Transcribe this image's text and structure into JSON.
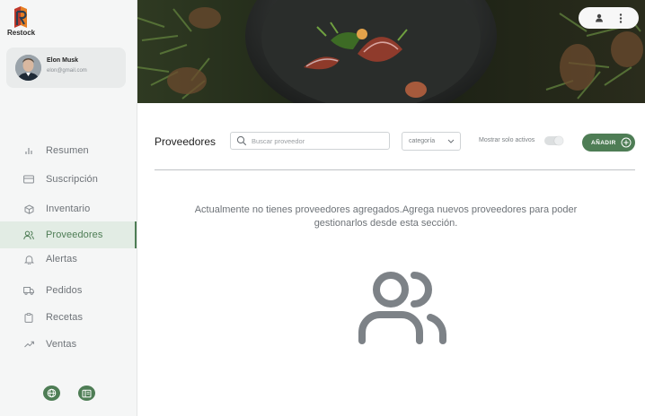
{
  "app": {
    "logo_text": "Restock"
  },
  "user": {
    "name": "Elon Musk",
    "email": "elon@gmail.com"
  },
  "sidebar": {
    "items": [
      {
        "label": "Resumen",
        "icon": "bar-chart-icon"
      },
      {
        "label": "Suscripción",
        "icon": "credit-card-icon"
      },
      {
        "label": "Inventario",
        "icon": "box-icon"
      },
      {
        "label": "Proveedores",
        "icon": "users-icon",
        "active": true
      },
      {
        "label": "Alertas",
        "icon": "bell-icon"
      },
      {
        "label": "Pedidos",
        "icon": "truck-icon"
      },
      {
        "label": "Recetas",
        "icon": "clipboard-icon"
      },
      {
        "label": "Ventas",
        "icon": "trend-up-icon"
      }
    ],
    "bottom_icons": [
      "globe-icon",
      "book-icon"
    ]
  },
  "toolbar": {
    "title": "Proveedores",
    "search_placeholder": "Buscar proveedor",
    "category_value": "categoría",
    "toggle_label": "Mostrar solo activos",
    "toggle_on": false,
    "add_label": "AÑADIR"
  },
  "empty_state": {
    "message": "Actualmente no tienes proveedores agregados.Agrega nuevos proveedores para poder gestionarlos desde esta sección.",
    "icon": "users-icon"
  },
  "colors": {
    "accent": "#4e7d55",
    "sidebar_bg": "#f5f6f6",
    "active_bg": "#e2ece4"
  }
}
